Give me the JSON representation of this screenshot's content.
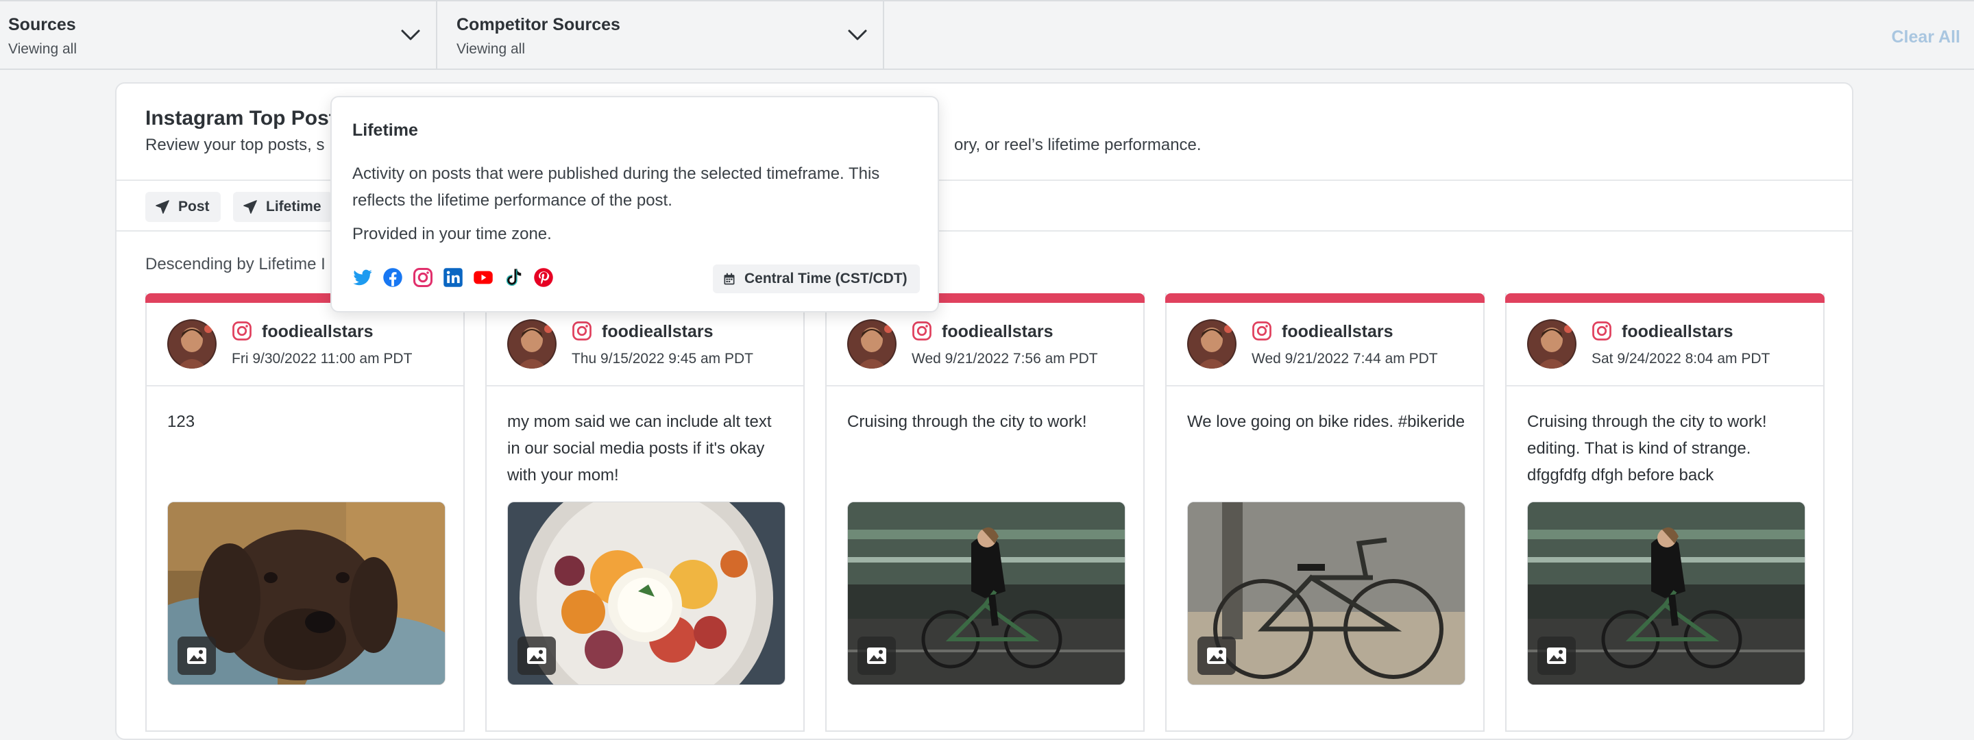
{
  "filters": {
    "sources": {
      "title": "Sources",
      "subtitle": "Viewing all"
    },
    "competitor": {
      "title": "Competitor Sources",
      "subtitle": "Viewing all"
    },
    "clear_all": "Clear All"
  },
  "panel": {
    "title": "Instagram Top Post",
    "description_start": "Review your top posts, s",
    "description_end": "ory, or reel’s lifetime performance.",
    "chips": [
      "Post",
      "Lifetime"
    ],
    "sort_label": "Descending by Lifetime I"
  },
  "tooltip": {
    "title": "Lifetime",
    "body": "Activity on posts that were published during the selected timeframe. This reflects the lifetime performance of the post.",
    "timezone_note": "Provided in your time zone.",
    "timezone_badge": "Central Time (CST/CDT)",
    "networks": [
      "twitter-icon",
      "facebook-icon",
      "instagram-icon",
      "linkedin-icon",
      "youtube-icon",
      "tiktok-icon",
      "pinterest-icon"
    ],
    "colors": {
      "twitter": "#1d9bf0",
      "facebook": "#1877f2",
      "instagram": "#e1306c",
      "linkedin": "#0a66c2",
      "youtube": "#ff0000",
      "tiktok": "#111111",
      "pinterest": "#e60023"
    }
  },
  "accent_color": "#e0415e",
  "posts": [
    {
      "handle": "foodieallstars",
      "date": "Fri 9/30/2022 11:00 am PDT",
      "text": "123",
      "media": "dog-photo"
    },
    {
      "handle": "foodieallstars",
      "date": "Thu 9/15/2022 9:45 am PDT",
      "text": "my mom said we can include alt text in our social media posts if it's okay with your mom!",
      "media": "food-photo"
    },
    {
      "handle": "foodieallstars",
      "date": "Wed 9/21/2022 7:56 am PDT",
      "text": "Cruising through the city to work!",
      "media": "cyclist-photo"
    },
    {
      "handle": "foodieallstars",
      "date": "Wed 9/21/2022 7:44 am PDT",
      "text": "We love going on bike rides. #bikeride",
      "media": "bicycle-photo"
    },
    {
      "handle": "foodieallstars",
      "date": "Sat 9/24/2022 8:04 am PDT",
      "text": "Cruising through the city to work! editing. That is kind of strange. dfggfdfg dfgh before back",
      "media": "cyclist-photo"
    }
  ]
}
